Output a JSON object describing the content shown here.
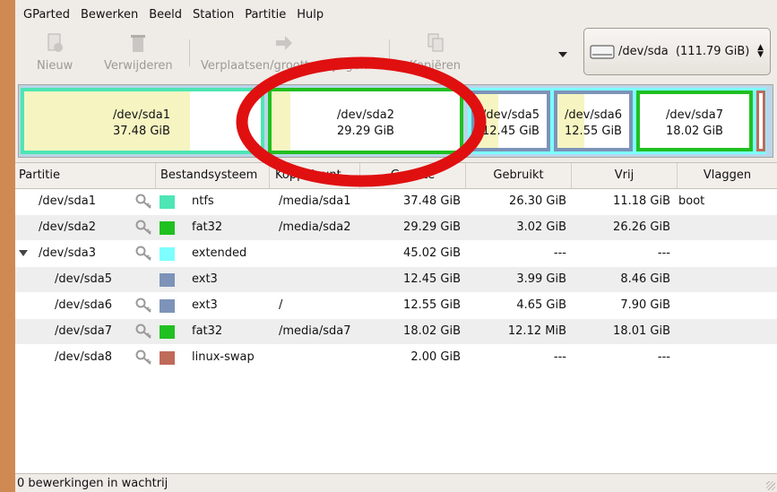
{
  "menu": [
    "GParted",
    "Bewerken",
    "Beeld",
    "Station",
    "Partitie",
    "Hulp"
  ],
  "toolbar": {
    "new_label": "Nieuw",
    "delete_label": "Verwijderen",
    "move_label": "Verplaatsen/grootte wijzigen",
    "copy_label": "Kopiëren"
  },
  "device": {
    "selected": "/dev/sda  (111.79 GiB)"
  },
  "map": [
    {
      "name": "/dev/sda1",
      "size": "37.48 GiB",
      "color": "#4de6b4",
      "used_frac": 0.7
    },
    {
      "name": "/dev/sda2",
      "size": "29.29 GiB",
      "color": "#20c020",
      "used_frac": 0.1
    },
    {
      "name": "/dev/sda5",
      "size": "12.45 GiB",
      "color": "#7d93b8",
      "used_frac": 0.32
    },
    {
      "name": "/dev/sda6",
      "size": "12.55 GiB",
      "color": "#7d93b8",
      "used_frac": 0.37
    },
    {
      "name": "/dev/sda7",
      "size": "18.02 GiB",
      "color": "#20c020",
      "used_frac": 0.0
    }
  ],
  "columns": [
    "Partitie",
    "Bestandsysteem",
    "Koppelpunt",
    "Grootte",
    "Gebruikt",
    "Vrij",
    "Vlaggen"
  ],
  "rows": [
    {
      "partition": "/dev/sda1",
      "fs": "ntfs",
      "color": "#4de6b4",
      "mount": "/media/sda1",
      "size": "37.48 GiB",
      "used": "26.30 GiB",
      "free": "11.18 GiB",
      "flags": "boot",
      "indent": 1,
      "key": true
    },
    {
      "partition": "/dev/sda2",
      "fs": "fat32",
      "color": "#20c020",
      "mount": "/media/sda2",
      "size": "29.29 GiB",
      "used": "3.02 GiB",
      "free": "26.26 GiB",
      "flags": "",
      "indent": 1,
      "key": true
    },
    {
      "partition": "/dev/sda3",
      "fs": "extended",
      "color": "#7dffff",
      "mount": "",
      "size": "45.02 GiB",
      "used": "---",
      "free": "---",
      "flags": "",
      "indent": 0,
      "key": true,
      "expander": true
    },
    {
      "partition": "/dev/sda5",
      "fs": "ext3",
      "color": "#7d93b8",
      "mount": "",
      "size": "12.45 GiB",
      "used": "3.99 GiB",
      "free": "8.46 GiB",
      "flags": "",
      "indent": 2,
      "key": false
    },
    {
      "partition": "/dev/sda6",
      "fs": "ext3",
      "color": "#7d93b8",
      "mount": "/",
      "size": "12.55 GiB",
      "used": "4.65 GiB",
      "free": "7.90 GiB",
      "flags": "",
      "indent": 2,
      "key": true
    },
    {
      "partition": "/dev/sda7",
      "fs": "fat32",
      "color": "#20c020",
      "mount": "/media/sda7",
      "size": "18.02 GiB",
      "used": "12.12 MiB",
      "free": "18.01 GiB",
      "flags": "",
      "indent": 2,
      "key": true
    },
    {
      "partition": "/dev/sda8",
      "fs": "linux-swap",
      "color": "#c06a5a",
      "mount": "",
      "size": "2.00 GiB",
      "used": "---",
      "free": "---",
      "flags": "",
      "indent": 2,
      "key": true
    }
  ],
  "status": "0 bewerkingen in wachtrij",
  "annotation_color": "#e01010"
}
